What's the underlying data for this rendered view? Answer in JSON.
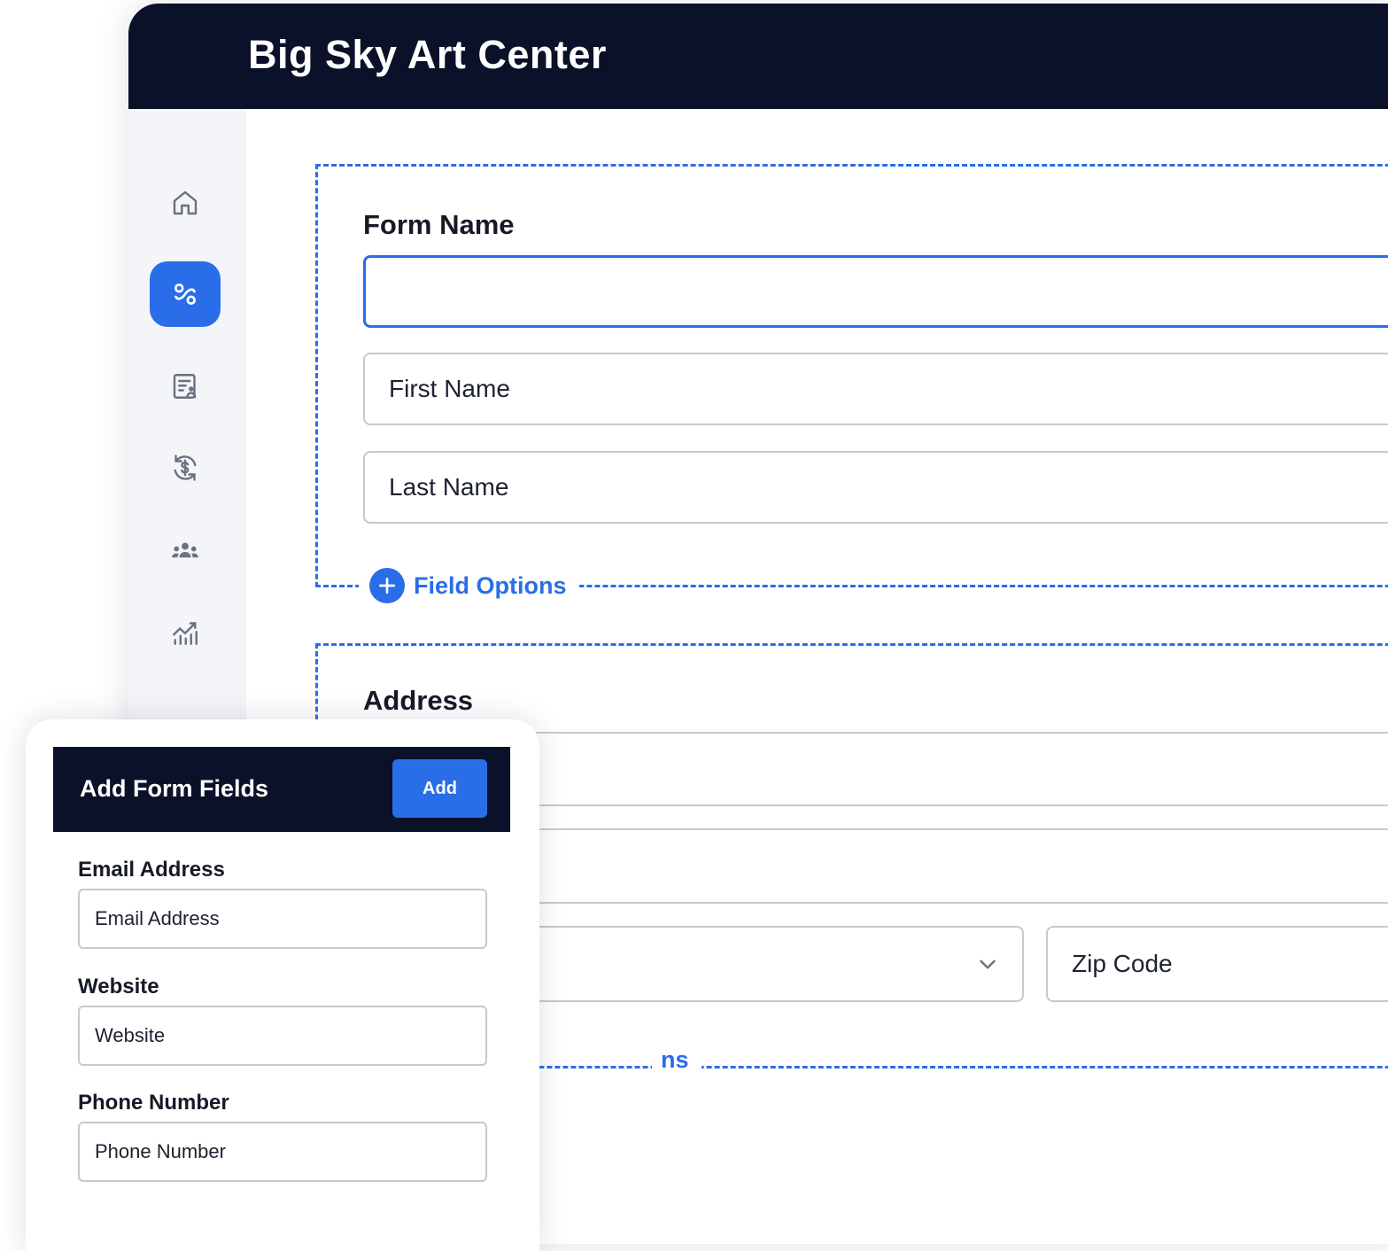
{
  "app": {
    "title": "Big Sky Art Center"
  },
  "sidebar": {
    "items": [
      {
        "icon": "home-icon",
        "active": false
      },
      {
        "icon": "form-builder-icon",
        "active": true
      },
      {
        "icon": "contact-form-icon",
        "active": false
      },
      {
        "icon": "recurring-payment-icon",
        "active": false
      },
      {
        "icon": "people-icon",
        "active": false
      },
      {
        "icon": "analytics-icon",
        "active": false
      }
    ]
  },
  "form_section": {
    "label": "Form Name",
    "name_value": "",
    "first_name_placeholder": "First Name",
    "last_name_placeholder": "Last Name",
    "field_options_label": "Field Options"
  },
  "address_section": {
    "label": "Address",
    "zip_placeholder": "Zip Code",
    "field_options_partial": "ns"
  },
  "add_fields_panel": {
    "title": "Add Form Fields",
    "add_label": "Add",
    "email": {
      "label": "Email Address",
      "placeholder": "Email Address"
    },
    "website": {
      "label": "Website",
      "placeholder": "Website"
    },
    "phone": {
      "label": "Phone Number",
      "placeholder": "Phone Number"
    }
  },
  "colors": {
    "accent": "#2a6de8",
    "header": "#0a1128",
    "border": "#c5c9d2"
  }
}
